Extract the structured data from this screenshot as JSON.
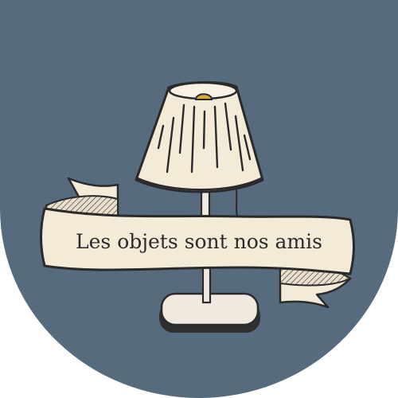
{
  "logo": {
    "tagline": "Les objets sont nos amis"
  },
  "colors": {
    "background": "#ffffff",
    "badge": "#566b7d",
    "cream": "#f3ead8",
    "outline": "#2a2a2a",
    "bulb": "#d9a838",
    "base_shadow": "#2f2f2f",
    "base_light": "#f1e9e0",
    "text": "#2b2b2b"
  },
  "icons": {
    "lamp": "table-lamp-icon",
    "ribbon": "ribbon-banner"
  }
}
